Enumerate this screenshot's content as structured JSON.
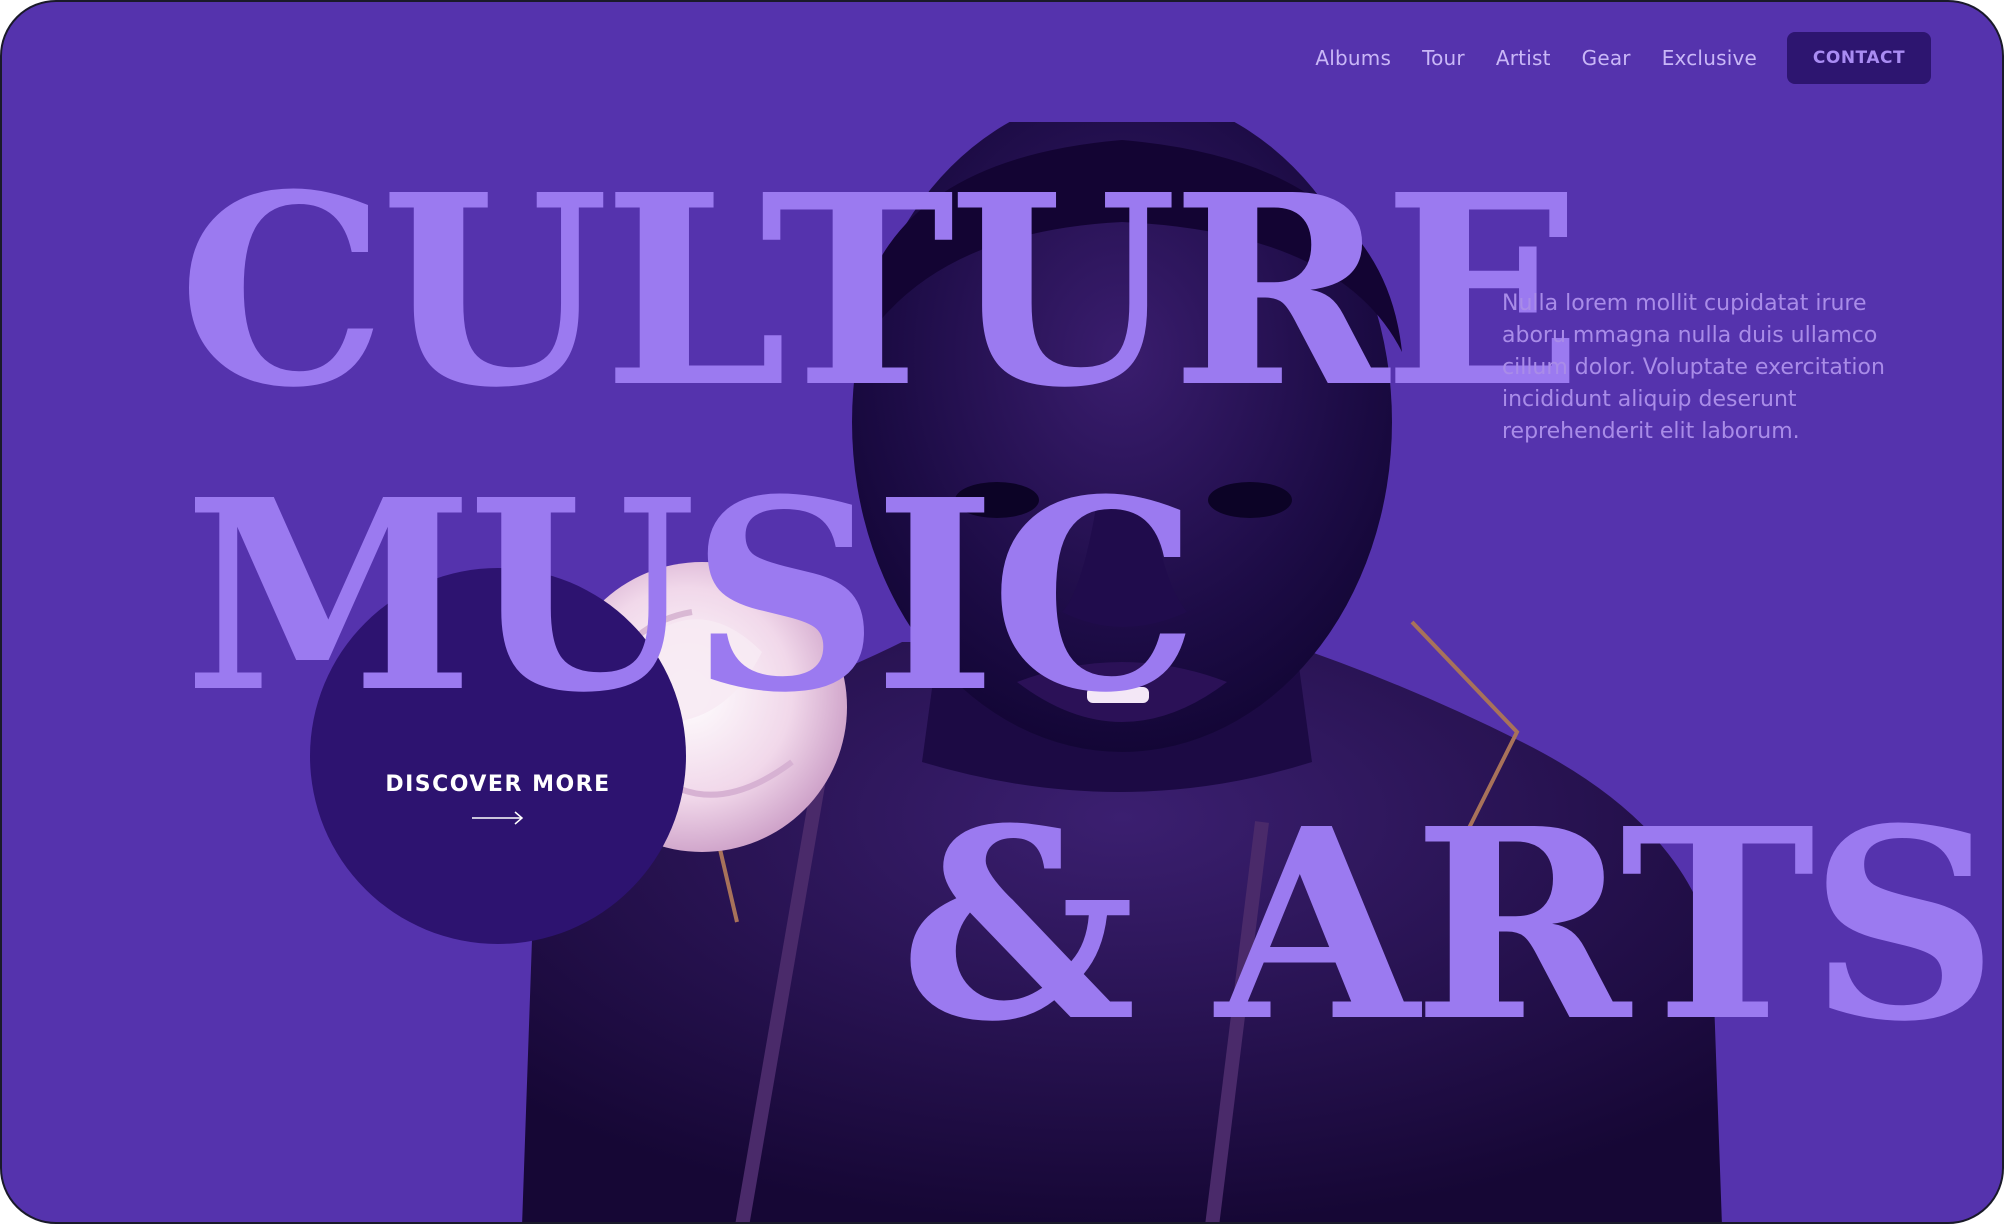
{
  "nav": {
    "links": [
      "Albums",
      "Tour",
      "Artist",
      "Gear",
      "Exclusive"
    ],
    "contact_label": "CONTACT"
  },
  "hero": {
    "headline_lines": [
      "CULTURE",
      "MUSIC",
      "& ARTS"
    ],
    "intro": "Nulla lorem mollit cupidatat irure aboru mmagna nulla duis ullamco cillum dolor. Voluptate exercitation incididunt aliquip deserunt reprehenderit elit laborum.",
    "cta_label": "DISCOVER MORE",
    "cta_icon": "arrow-right-icon",
    "portrait_icon": "portrait-photo"
  },
  "colors": {
    "background": "#5533ad",
    "headline": "#9b7af0",
    "disc": "#2d1370",
    "contact_button": "#2d1570",
    "nav_text": "#c9b7f7",
    "intro_text": "#a98ce8"
  }
}
